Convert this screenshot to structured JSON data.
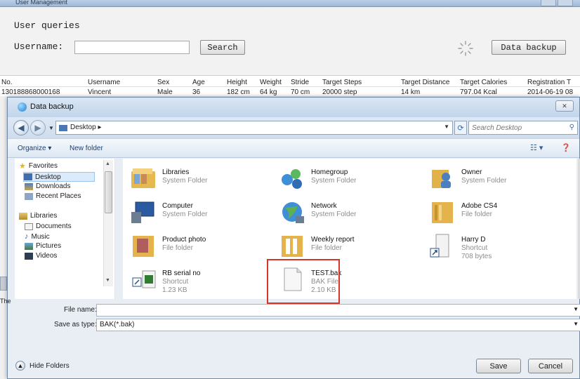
{
  "app": {
    "title": "User Management",
    "query_title": "User queries",
    "username_label": "Username:",
    "username_value": "",
    "search_label": "Search",
    "backup_label": "Data backup"
  },
  "table": {
    "headers": [
      "No.",
      "Username",
      "Sex",
      "Age",
      "Height",
      "Weight",
      "Stride",
      "Target Steps",
      "Target Distance",
      "Target Calories",
      "Registration T"
    ],
    "rows": [
      [
        "130188868000168",
        "Vincent",
        "Male",
        "36",
        "182 cm",
        "64 kg",
        "70 cm",
        "20000 step",
        "14 km",
        "797.04 Kcal",
        "2014-06-19 08"
      ]
    ]
  },
  "dialog": {
    "title": "Data backup",
    "close_glyph": "✕",
    "address": "Desktop",
    "search_placeholder": "Search Desktop",
    "organize_label": "Organize ▾",
    "new_folder_label": "New folder",
    "nav": {
      "favorites": "Favorites",
      "desktop": "Desktop",
      "downloads": "Downloads",
      "recent": "Recent Places",
      "libraries": "Libraries",
      "documents": "Documents",
      "music": "Music",
      "pictures": "Pictures",
      "videos": "Videos"
    },
    "files": [
      {
        "name": "Libraries",
        "type": "System Folder",
        "size": ""
      },
      {
        "name": "Homegroup",
        "type": "System Folder",
        "size": ""
      },
      {
        "name": "Owner",
        "type": "System Folder",
        "size": ""
      },
      {
        "name": "Computer",
        "type": "System Folder",
        "size": ""
      },
      {
        "name": "Network",
        "type": "System Folder",
        "size": ""
      },
      {
        "name": "Adobe CS4",
        "type": "File folder",
        "size": ""
      },
      {
        "name": "Product photo",
        "type": "File folder",
        "size": ""
      },
      {
        "name": "Weekly report",
        "type": "File folder",
        "size": ""
      },
      {
        "name": "Harry D",
        "type": "Shortcut",
        "size": "708 bytes"
      },
      {
        "name": "RB serial no",
        "type": "Shortcut",
        "size": "1.23 KB"
      },
      {
        "name": "TEST.bak",
        "type": "BAK File",
        "size": "2.10 KB"
      }
    ],
    "file_name_label": "File name:",
    "file_name_value": "",
    "save_type_label": "Save as type:",
    "save_type_value": "BAK(*.bak)",
    "hide_folders_label": "Hide Folders",
    "save_label": "Save",
    "cancel_label": "Cancel"
  },
  "colors": {
    "highlight": "#d9342a",
    "accent": "#1d3f6e"
  }
}
